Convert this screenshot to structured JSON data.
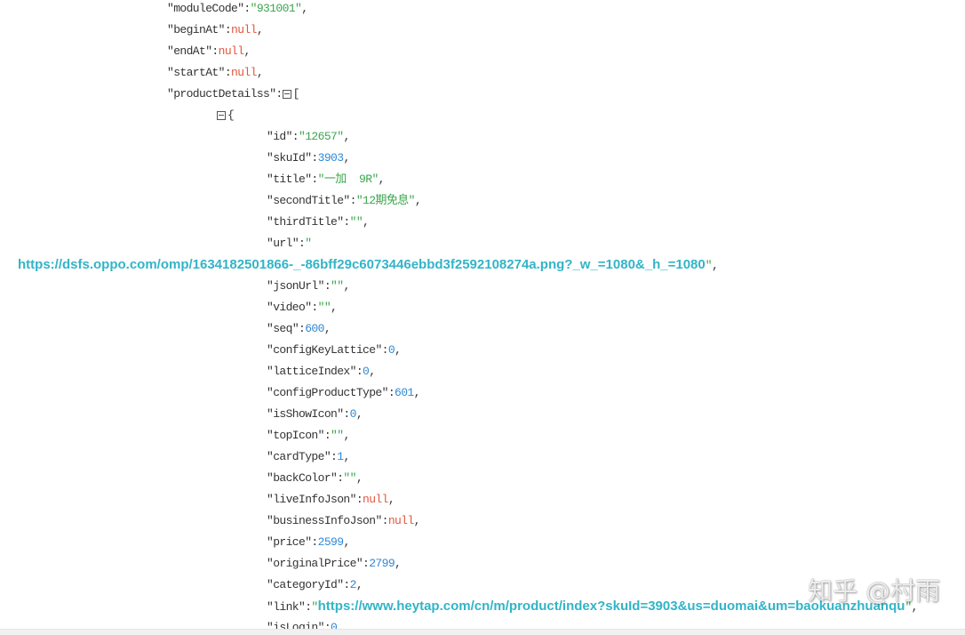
{
  "root_fields": [
    {
      "key": "moduleCode",
      "value": "931001"
    },
    {
      "key": "beginAt",
      "value": "null"
    },
    {
      "key": "endAt",
      "value": "null"
    },
    {
      "key": "startAt",
      "value": "null"
    }
  ],
  "product_details": {
    "key": "productDetailss",
    "toggle_icon": "collapse-icon",
    "open_bracket": "[",
    "item": {
      "toggle_icon": "collapse-icon",
      "open_brace": "{",
      "fields": [
        {
          "key": "id",
          "value": "12657"
        },
        {
          "key": "skuId",
          "value": 3903
        },
        {
          "key": "title",
          "value": "一加  9R"
        },
        {
          "key": "secondTitle",
          "value": "12期免息"
        },
        {
          "key": "thirdTitle",
          "value": ""
        },
        {
          "key": "url",
          "value": "https://dsfs.oppo.com/omp/1634182501866-_-86bff29c6073446ebbd3f2592108274a.png?_w_=1080&_h_=1080"
        },
        {
          "key": "jsonUrl",
          "value": ""
        },
        {
          "key": "video",
          "value": ""
        },
        {
          "key": "seq",
          "value": 600
        },
        {
          "key": "configKeyLattice",
          "value": 0
        },
        {
          "key": "latticeIndex",
          "value": 0
        },
        {
          "key": "configProductType",
          "value": 601
        },
        {
          "key": "isShowIcon",
          "value": 0
        },
        {
          "key": "topIcon",
          "value": ""
        },
        {
          "key": "cardType",
          "value": 1
        },
        {
          "key": "backColor",
          "value": ""
        },
        {
          "key": "liveInfoJson",
          "value": "null"
        },
        {
          "key": "businessInfoJson",
          "value": "null"
        },
        {
          "key": "price",
          "value": 2599
        },
        {
          "key": "originalPrice",
          "value": 2799
        },
        {
          "key": "categoryId",
          "value": 2
        },
        {
          "key": "link",
          "value": "https://www.heytap.com/cn/m/product/index?skuId=3903&us=duomai&um=baokuanzhuanqu"
        },
        {
          "key": "isLogin",
          "value": 0
        }
      ]
    }
  },
  "watermark": {
    "text": "知乎 @村雨"
  },
  "colors": {
    "key": "#333333",
    "string": "#3ba64d",
    "number": "#2e88d6",
    "null": "#e2573c",
    "link": "#32b4c8",
    "toggle": "#555555"
  }
}
